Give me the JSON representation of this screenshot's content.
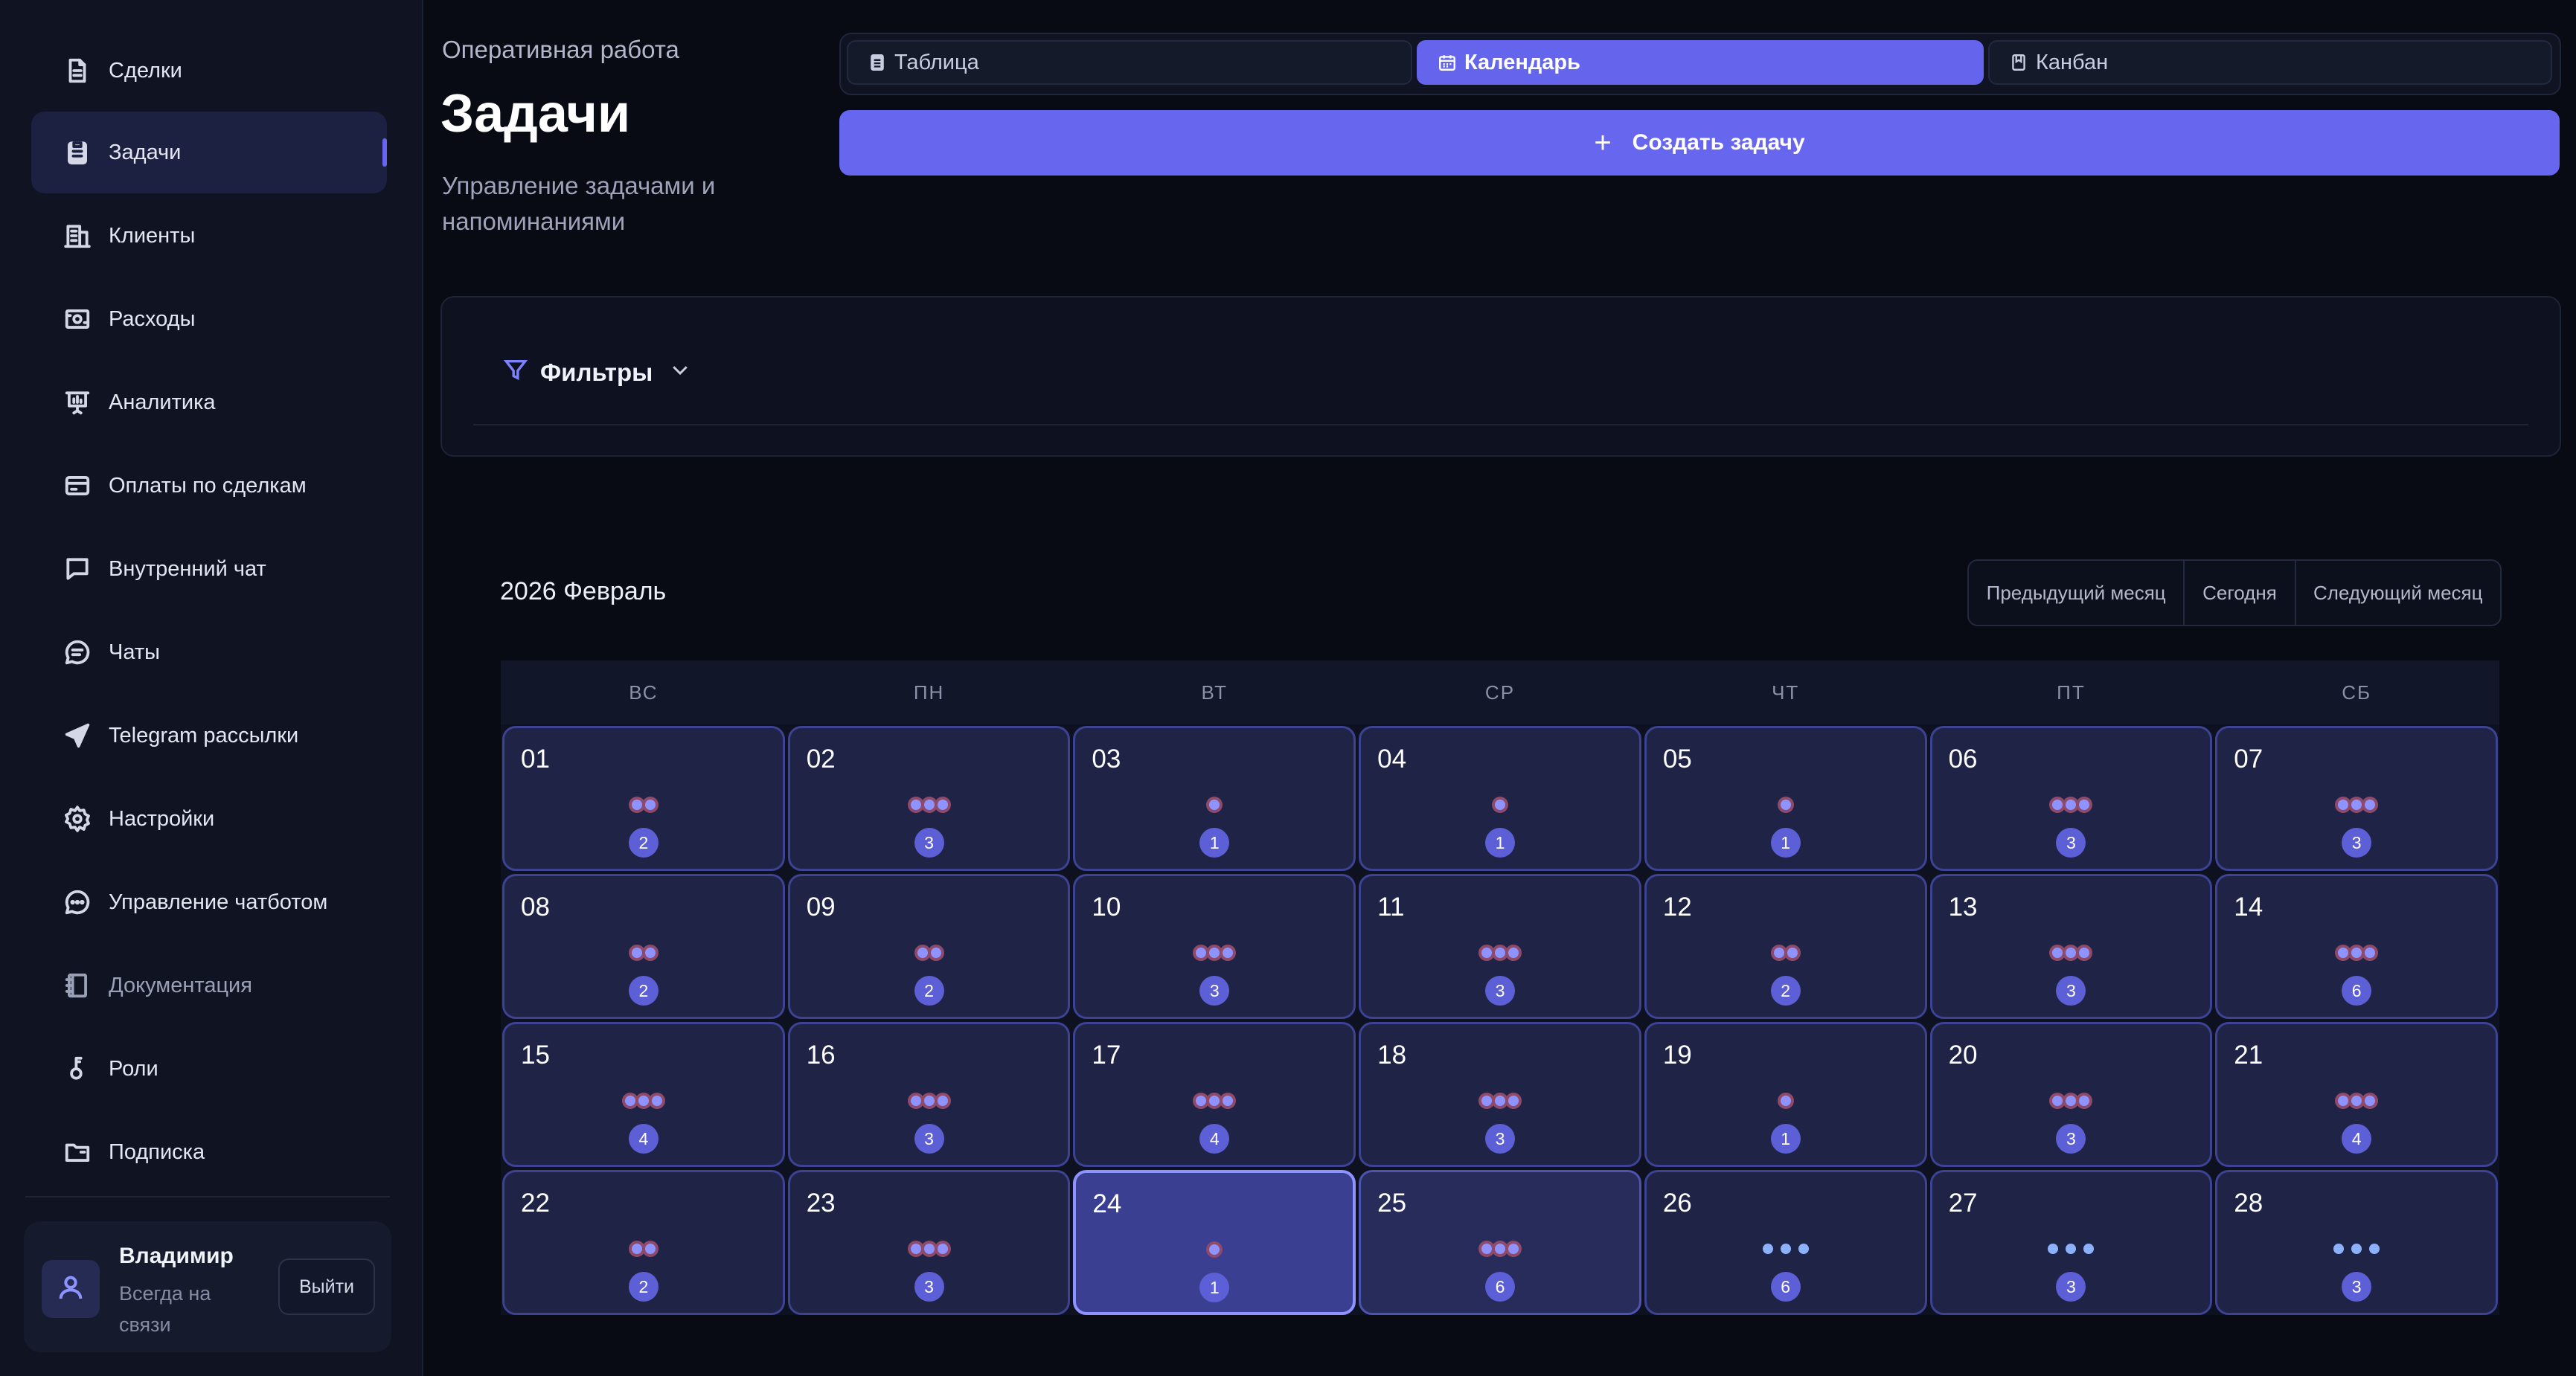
{
  "sidebar": {
    "items": [
      {
        "label": "Сделки",
        "icon": "document-icon"
      },
      {
        "label": "Задачи",
        "icon": "clipboard-icon",
        "active": true
      },
      {
        "label": "Клиенты",
        "icon": "building-icon"
      },
      {
        "label": "Расходы",
        "icon": "wallet-icon"
      },
      {
        "label": "Аналитика",
        "icon": "presentation-chart-icon"
      },
      {
        "label": "Оплаты по сделкам",
        "icon": "credit-card-icon"
      },
      {
        "label": "Внутренний чат",
        "icon": "chat-square-icon"
      },
      {
        "label": "Чаты",
        "icon": "chat-bubble-icon"
      },
      {
        "label": "Telegram рассылки",
        "icon": "paper-plane-icon"
      },
      {
        "label": "Настройки",
        "icon": "gear-icon"
      },
      {
        "label": "Управление чатботом",
        "icon": "chatbot-icon"
      },
      {
        "label": "Документация",
        "icon": "book-icon",
        "muted": true
      },
      {
        "label": "Роли",
        "icon": "key-icon"
      },
      {
        "label": "Подписка",
        "icon": "folder-icon"
      }
    ],
    "user": {
      "name": "Владимир",
      "status": "Всегда на связи",
      "logout_label": "Выйти"
    }
  },
  "header": {
    "breadcrumb": "Оперативная работа",
    "title": "Задачи",
    "subtitle": "Управление задачами и напоминаниями"
  },
  "view_tabs": [
    {
      "label": "Таблица",
      "icon": "table-icon"
    },
    {
      "label": "Календарь",
      "icon": "calendar-icon",
      "active": true
    },
    {
      "label": "Канбан",
      "icon": "kanban-icon"
    }
  ],
  "create_button": {
    "label": "Создать задачу",
    "icon": "plus-icon"
  },
  "filters": {
    "label": "Фильтры"
  },
  "calendar": {
    "month_label": "2026 Февраль",
    "nav": {
      "prev": "Предыдущий месяц",
      "today": "Сегодня",
      "next": "Следующий месяц"
    },
    "weekdays": [
      "ВС",
      "ПН",
      "ВТ",
      "СР",
      "ЧТ",
      "ПТ",
      "СБ"
    ],
    "days": [
      {
        "num": "01",
        "dots": 2,
        "count": "2"
      },
      {
        "num": "02",
        "dots": 3,
        "count": "3"
      },
      {
        "num": "03",
        "dots": 1,
        "count": "1"
      },
      {
        "num": "04",
        "dots": 1,
        "count": "1"
      },
      {
        "num": "05",
        "dots": 1,
        "count": "1"
      },
      {
        "num": "06",
        "dots": 3,
        "count": "3"
      },
      {
        "num": "07",
        "dots": 3,
        "count": "3"
      },
      {
        "num": "08",
        "dots": 2,
        "count": "2"
      },
      {
        "num": "09",
        "dots": 2,
        "count": "2"
      },
      {
        "num": "10",
        "dots": 3,
        "count": "3"
      },
      {
        "num": "11",
        "dots": 3,
        "count": "3"
      },
      {
        "num": "12",
        "dots": 2,
        "count": "2"
      },
      {
        "num": "13",
        "dots": 3,
        "count": "3"
      },
      {
        "num": "14",
        "dots": 3,
        "count": "6"
      },
      {
        "num": "15",
        "dots": 3,
        "count": "4"
      },
      {
        "num": "16",
        "dots": 3,
        "count": "3"
      },
      {
        "num": "17",
        "dots": 3,
        "count": "4"
      },
      {
        "num": "18",
        "dots": 3,
        "count": "3"
      },
      {
        "num": "19",
        "dots": 1,
        "count": "1"
      },
      {
        "num": "20",
        "dots": 3,
        "count": "3"
      },
      {
        "num": "21",
        "dots": 3,
        "count": "4"
      },
      {
        "num": "22",
        "dots": 2,
        "count": "2"
      },
      {
        "num": "23",
        "dots": 3,
        "count": "3"
      },
      {
        "num": "24",
        "dots": 1,
        "count": "1",
        "state": "today"
      },
      {
        "num": "25",
        "dots": 3,
        "count": "6",
        "state": "highlight"
      },
      {
        "num": "26",
        "dots": 3,
        "count": "6",
        "dot_style": "plain"
      },
      {
        "num": "27",
        "dots": 3,
        "count": "3",
        "dot_style": "plain"
      },
      {
        "num": "28",
        "dots": 3,
        "count": "3",
        "dot_style": "plain"
      }
    ]
  },
  "colors": {
    "accent": "#6666ee",
    "background": "#080a14",
    "sidebar": "#0f1322",
    "day_cell": "#1f2447",
    "today_cell": "#3b3f91",
    "dot_ring": "#8f4a6a"
  }
}
